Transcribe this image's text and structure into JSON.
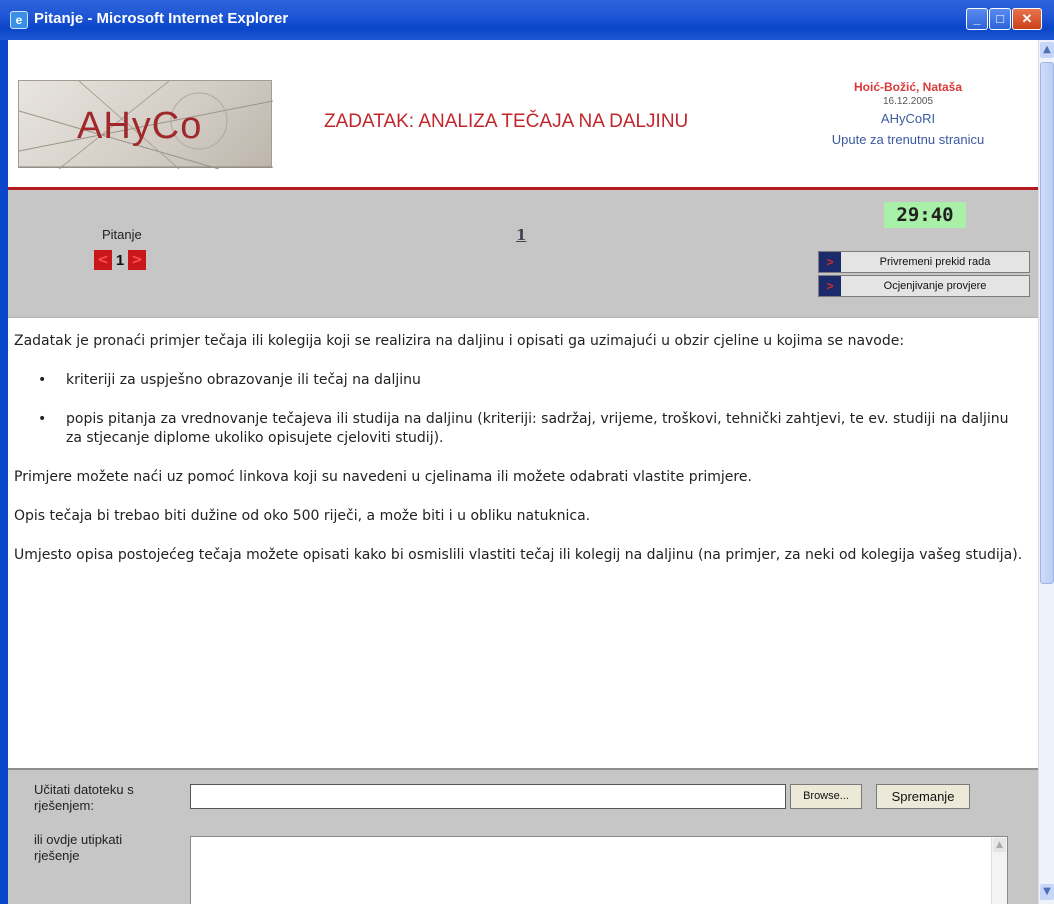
{
  "window": {
    "title": "Pitanje - Microsoft Internet Explorer",
    "app_icon": "ie-icon",
    "minimize": "_",
    "maximize": "□",
    "close": "✕"
  },
  "header": {
    "logo_text": "AHyCo",
    "task_title": "ZADATAK: ANALIZA TEČAJA NA DALJINU",
    "user_name": "Hoić-Božić, Nataša",
    "date": "16.12.2005",
    "app_code": "AHyCoRI",
    "help_link": "Upute za trenutnu stranicu"
  },
  "nav": {
    "question_label": "Pitanje",
    "prev_symbol": "<",
    "next_symbol": ">",
    "current_question": "1",
    "question_index_link": "1",
    "timer": "29:40",
    "pause_button": "Privremeni prekid rada",
    "grade_button": "Ocjenjivanje provjere",
    "button_marker": ">"
  },
  "task": {
    "intro": "Zadatak je pronaći primjer tečaja ili kolegija koji se realizira na daljinu i opisati ga uzimajući u obzir cjeline u kojima se navode:",
    "bullets": [
      "kriteriji za uspješno obrazovanje ili tečaj na daljinu",
      "popis pitanja za vrednovanje tečajeva ili studija na daljinu (kriteriji: sadržaj, vrijeme, troškovi, tehnički zahtjevi, te ev. studiji na daljinu za stjecanje diplome ukoliko opisujete cjeloviti studij)."
    ],
    "para2": "Primjere možete naći uz pomoć linkova koji su navedeni u cjelinama ili možete odabrati  vlastite primjere.",
    "para3": "Opis tečaja bi trebao biti dužine od oko 500 riječi, a može biti i u obliku natuknica.",
    "para4": "Umjesto opisa postojećeg tečaja možete opisati kako bi osmislili vlastiti tečaj ili kolegij na daljinu (na primjer, za neki od kolegija vašeg studija)."
  },
  "upload": {
    "file_label": "Učitati datoteku s rješenjem:",
    "file_value": "",
    "browse_label": "Browse...",
    "save_label": "Spremanje",
    "type_label": "ili ovdje utipkati rješenje",
    "text_value": ""
  },
  "colors": {
    "title_bar": "#1f56d6",
    "accent_red": "#c0262b",
    "band_grey": "#c6c6c6",
    "timer_bg": "#a8f0a8"
  }
}
